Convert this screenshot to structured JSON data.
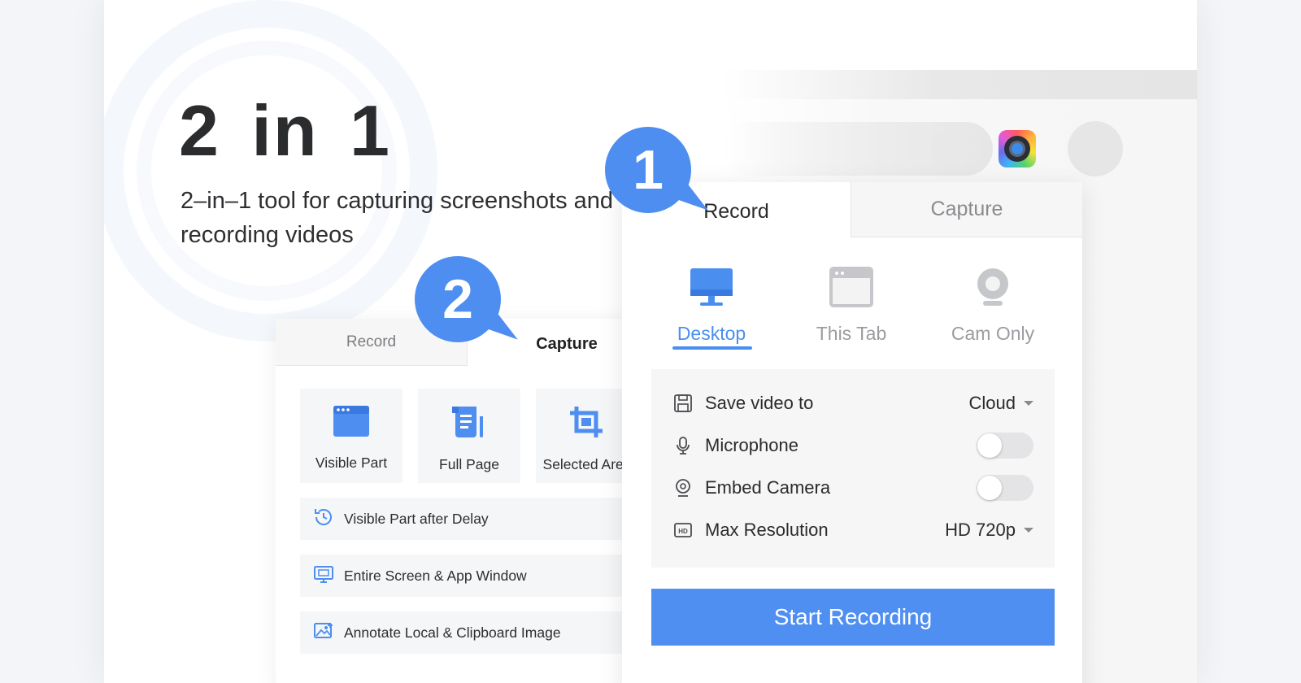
{
  "hero": {
    "title": "2 in 1",
    "subtitle": "2–in–1 tool for capturing screenshots and recording videos"
  },
  "badges": {
    "first": "1",
    "second": "2"
  },
  "capture_panel": {
    "tabs": {
      "record": "Record",
      "capture": "Capture"
    },
    "tiles": [
      {
        "label": "Visible Part",
        "icon": "browser-window-icon"
      },
      {
        "label": "Full Page",
        "icon": "scroll-page-icon"
      },
      {
        "label": "Selected Area",
        "icon": "crop-icon"
      }
    ],
    "rows": [
      {
        "label": "Visible Part after Delay",
        "icon": "timer-icon"
      },
      {
        "label": "Entire Screen & App Window",
        "icon": "monitor-icon"
      },
      {
        "label": "Annotate Local & Clipboard Image",
        "icon": "image-icon"
      }
    ]
  },
  "record_panel": {
    "tabs": {
      "record": "Record",
      "capture": "Capture"
    },
    "modes": [
      {
        "label": "Desktop",
        "icon": "desktop-icon",
        "active": true
      },
      {
        "label": "This Tab",
        "icon": "tab-window-icon",
        "active": false
      },
      {
        "label": "Cam Only",
        "icon": "webcam-icon",
        "active": false
      }
    ],
    "settings": {
      "save_label": "Save video to",
      "save_value": "Cloud",
      "mic_label": "Microphone",
      "mic_on": false,
      "camera_label": "Embed Camera",
      "camera_on": false,
      "res_label": "Max Resolution",
      "res_value": "HD 720p"
    },
    "start_label": "Start Recording"
  },
  "colors": {
    "accent": "#4f8ff2",
    "badge": "#4d8ef0",
    "panel_bg": "#f6f6f7",
    "text": "#2a2b2d",
    "muted": "#9a9ca0"
  }
}
